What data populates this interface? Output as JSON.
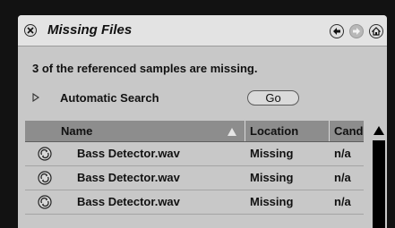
{
  "window": {
    "title": "Missing Files"
  },
  "summary": "3 of the referenced samples are missing.",
  "automatic_search": {
    "label": "Automatic Search",
    "go_label": "Go"
  },
  "table": {
    "columns": [
      "Name",
      "Location",
      "Candi"
    ],
    "rows": [
      {
        "name": "Bass Detector.wav",
        "location": "Missing",
        "candidates": "n/a"
      },
      {
        "name": "Bass Detector.wav",
        "location": "Missing",
        "candidates": "n/a"
      },
      {
        "name": "Bass Detector.wav",
        "location": "Missing",
        "candidates": "n/a"
      }
    ]
  },
  "icons": {
    "close": "close-icon",
    "back": "arrow-left-icon",
    "forward": "arrow-right-icon",
    "home": "home-icon",
    "row": "hot-swap-icon",
    "sort": "sort-ascending-icon",
    "disclosure": "disclosure-triangle-icon",
    "scroll_up": "scroll-up-arrow-icon"
  }
}
